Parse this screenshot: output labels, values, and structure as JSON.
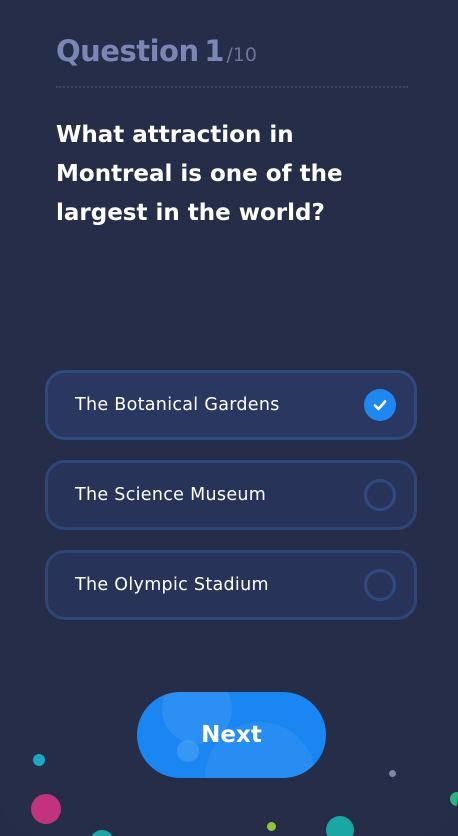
{
  "header": {
    "word": "Question",
    "number": "1",
    "total": "/10"
  },
  "question": {
    "text": "What attraction in Montreal is one of the largest in the world?"
  },
  "options": [
    {
      "label": "The Botanical Gardens",
      "selected": true
    },
    {
      "label": "The Science Museum",
      "selected": false
    },
    {
      "label": "The Olympic Stadium",
      "selected": false
    }
  ],
  "next_button": {
    "label": "Next"
  },
  "colors": {
    "background": "#262d49",
    "accent": "#1a86f2",
    "option_border": "#2e4677",
    "header_text": "#7b86b4"
  },
  "icons": {
    "selected": "check-circle-icon",
    "unselected": "radio-circle-icon"
  }
}
